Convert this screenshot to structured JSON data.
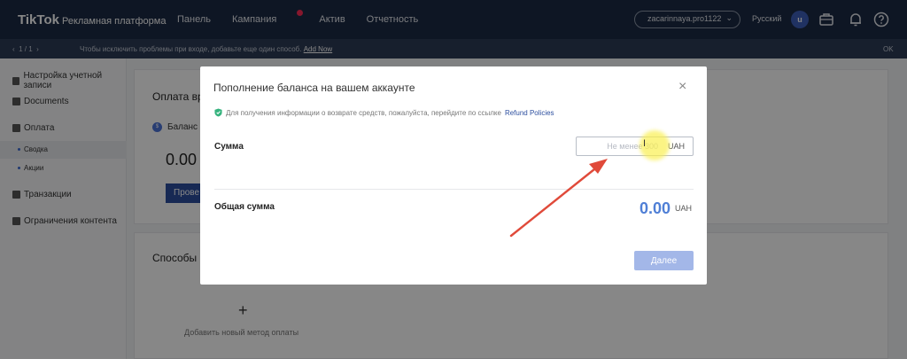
{
  "header": {
    "logo": "TikTok",
    "logo_sub": "Рекламная платформа",
    "nav": [
      "Панель",
      "Кампания",
      "Актив",
      "Отчетность"
    ],
    "account": "zacarinnaya.pro1122",
    "language": "Русский",
    "avatar_letter": "u"
  },
  "notice": {
    "pager": "1 / 1",
    "message": "Чтобы исключить проблемы при входе, добавьте еще один способ.",
    "link": "Add Now",
    "ok": "OK"
  },
  "sidebar": {
    "items": [
      {
        "label": "Настройка учетной записи"
      },
      {
        "label": "Documents"
      },
      {
        "label": "Оплата"
      },
      {
        "label": "Транзакции"
      },
      {
        "label": "Ограничения контента"
      }
    ],
    "subitems": [
      "Сводка",
      "Акции"
    ]
  },
  "background": {
    "section_title": "Оплата вр",
    "balance_label": "Баланс",
    "balance_value": "0.00",
    "button": "Прове",
    "methods_title": "Способы о",
    "plus": "+",
    "add_method": "Добавить новый метод оплаты"
  },
  "modal": {
    "title": "Пополнение баланса на вашем аккаунте",
    "info": "Для получения информации о возврате средств, пожалуйста, перейдите по ссылке",
    "info_link": "Refund Policies",
    "amount_label": "Сумма",
    "amount_placeholder": "Не менее 300",
    "currency": "UAH",
    "total_label": "Общая сумма",
    "total_value": "0.00",
    "total_currency": "UAH",
    "next_button": "Далее"
  },
  "colors": {
    "nav_bg": "#1c2a44",
    "accent": "#4f7fd6",
    "button_disabled": "#a3b7e8",
    "arrow": "#e04a3a"
  }
}
